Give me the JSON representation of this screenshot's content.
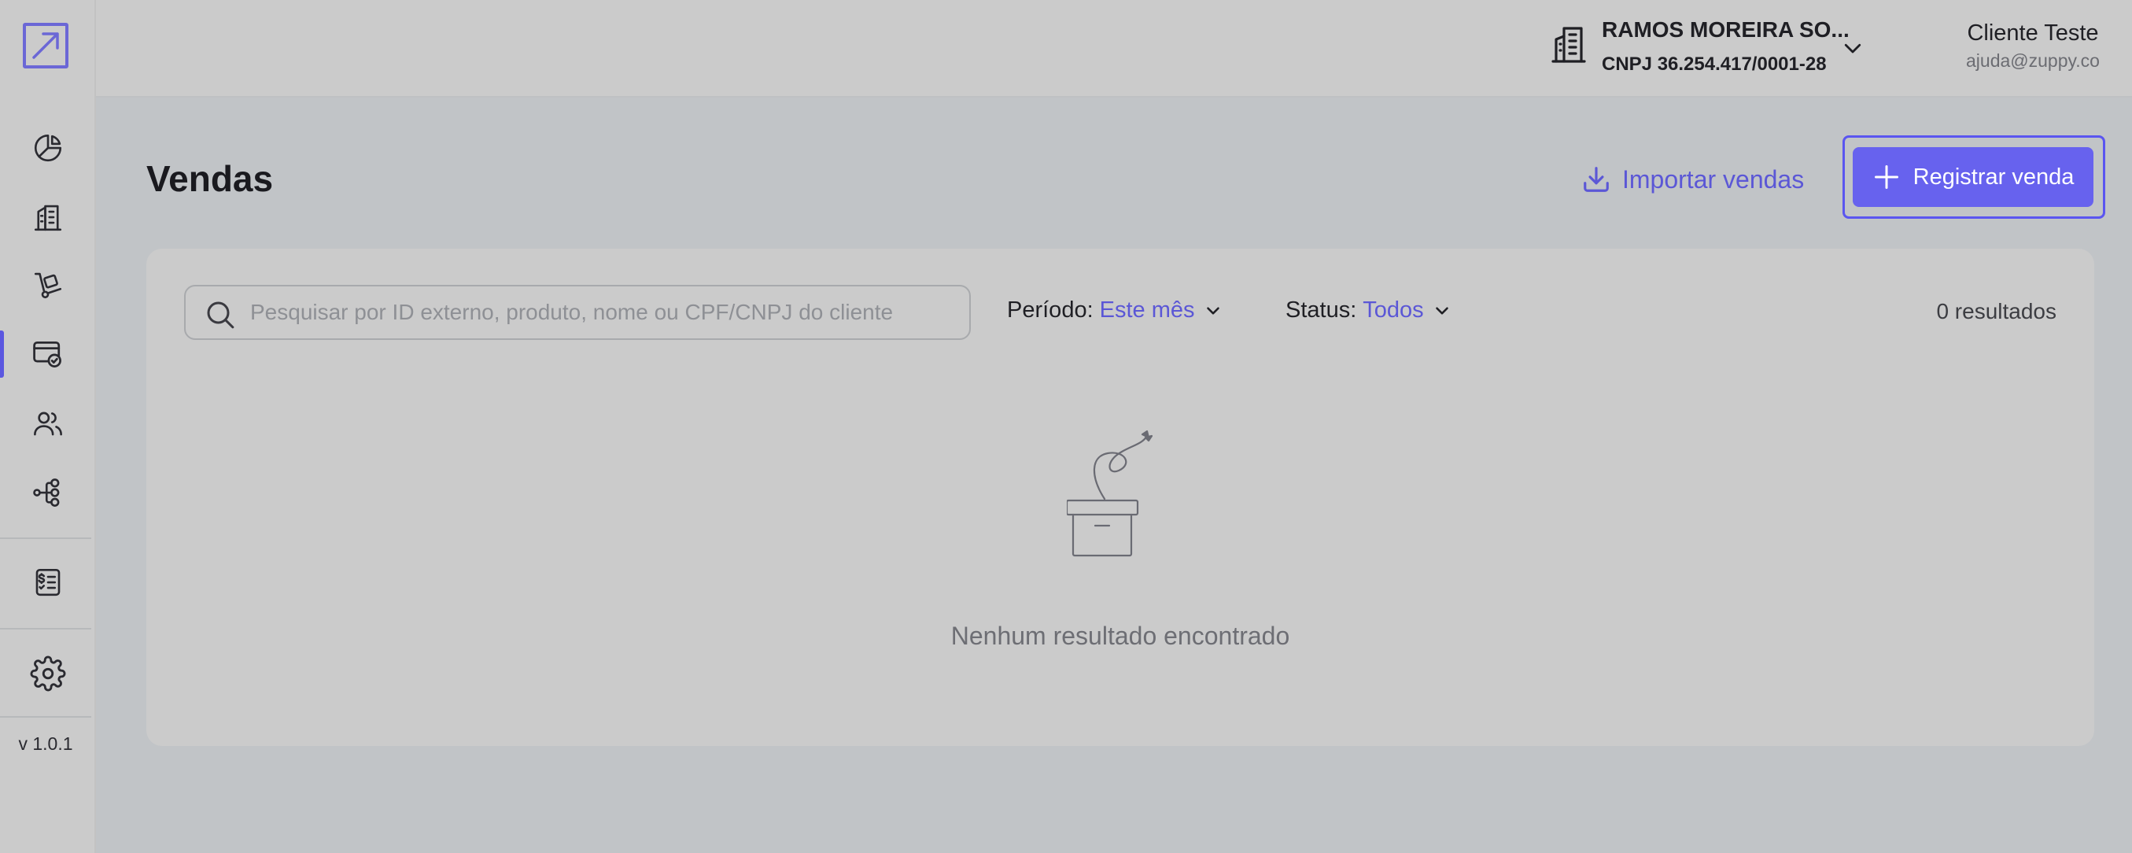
{
  "app": {
    "version": "v 1.0.1",
    "accent_color": "#6762ee"
  },
  "sidebar": {
    "items": [
      {
        "icon": "pie-chart-icon",
        "label": "dashboard"
      },
      {
        "icon": "building-icon",
        "label": "companies"
      },
      {
        "icon": "hand-truck-icon",
        "label": "products"
      },
      {
        "icon": "sales-icon",
        "label": "sales",
        "active": true
      },
      {
        "icon": "users-icon",
        "label": "customers"
      },
      {
        "icon": "flow-icon",
        "label": "integrations"
      },
      {
        "icon": "tax-document-icon",
        "label": "invoices"
      },
      {
        "icon": "gear-icon",
        "label": "settings"
      }
    ]
  },
  "header": {
    "company_name": "RAMOS MOREIRA SO...",
    "company_cnpj": "CNPJ 36.254.417/0001-28",
    "user_name": "Cliente Teste",
    "user_email": "ajuda@zuppy.co"
  },
  "page": {
    "title": "Vendas",
    "import_label": "Importar vendas",
    "register_label": "Registrar venda"
  },
  "filters": {
    "search_placeholder": "Pesquisar por ID externo, produto, nome ou CPF/CNPJ do cliente",
    "period_label": "Período:",
    "period_value": "Este mês",
    "status_label": "Status:",
    "status_value": "Todos",
    "results_count": "0 resultados"
  },
  "empty_state": {
    "message": "Nenhum resultado encontrado"
  }
}
